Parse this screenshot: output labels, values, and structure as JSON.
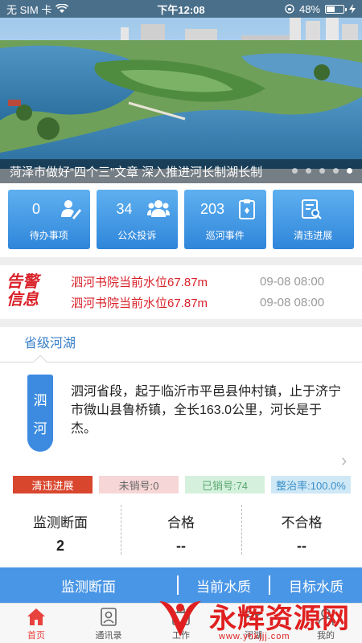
{
  "status_bar": {
    "carrier": "无 SIM 卡",
    "time": "下午12:08",
    "battery": "48%",
    "battery_level": 0.48
  },
  "banner": {
    "caption": "菏泽市做好“四个三”文章 深入推进河长制湖长制",
    "dot_count": 5,
    "active_dot": 4
  },
  "tiles": [
    {
      "count": "0",
      "label": "待办事项",
      "icon": "person-edit-icon"
    },
    {
      "count": "34",
      "label": "公众投诉",
      "icon": "people-icon"
    },
    {
      "count": "203",
      "label": "巡河事件",
      "icon": "clipboard-icon"
    },
    {
      "count": "",
      "label": "清违进展",
      "icon": "document-search-icon"
    }
  ],
  "alerts": {
    "logo_line1": "告警",
    "logo_line2": "信息",
    "items": [
      {
        "text": "泗河书院当前水位67.87m",
        "time": "09-08 08:00"
      },
      {
        "text": "泗河书院当前水位67.87m",
        "time": "09-08 08:00"
      }
    ]
  },
  "lakes": {
    "tab_label": "省级河湖",
    "river_name_1": "泗",
    "river_name_2": "河",
    "description": "泗河省段，起于临沂市平邑县仲村镇，止于济宁市微山县鲁桥镇，全长163.0公里，河长是于杰。",
    "stats": [
      "清违进展",
      "未销号:0",
      "已销号:74",
      "整治率:100.0%"
    ]
  },
  "monitor": {
    "columns": [
      {
        "head": "监测断面",
        "value": "2"
      },
      {
        "head": "合格",
        "value": "--"
      },
      {
        "head": "不合格",
        "value": "--"
      }
    ]
  },
  "quality_strip": [
    "监测断面",
    "当前水质",
    "目标水质"
  ],
  "tabbar": [
    {
      "label": "首页",
      "active": true,
      "icon": "home-icon"
    },
    {
      "label": "通讯录",
      "active": false,
      "icon": "contacts-icon"
    },
    {
      "label": "工作",
      "active": false,
      "icon": "work-icon"
    },
    {
      "label": "河湖",
      "active": false,
      "icon": "river-icon"
    },
    {
      "label": "我的",
      "active": false,
      "icon": "profile-icon"
    }
  ],
  "watermark": {
    "text": "永辉资源网",
    "url": "www.yhkjjj.com"
  },
  "colors": {
    "accent": "#3c8be0",
    "alert_red": "#d9222a",
    "tab_active": "#e8423f"
  }
}
